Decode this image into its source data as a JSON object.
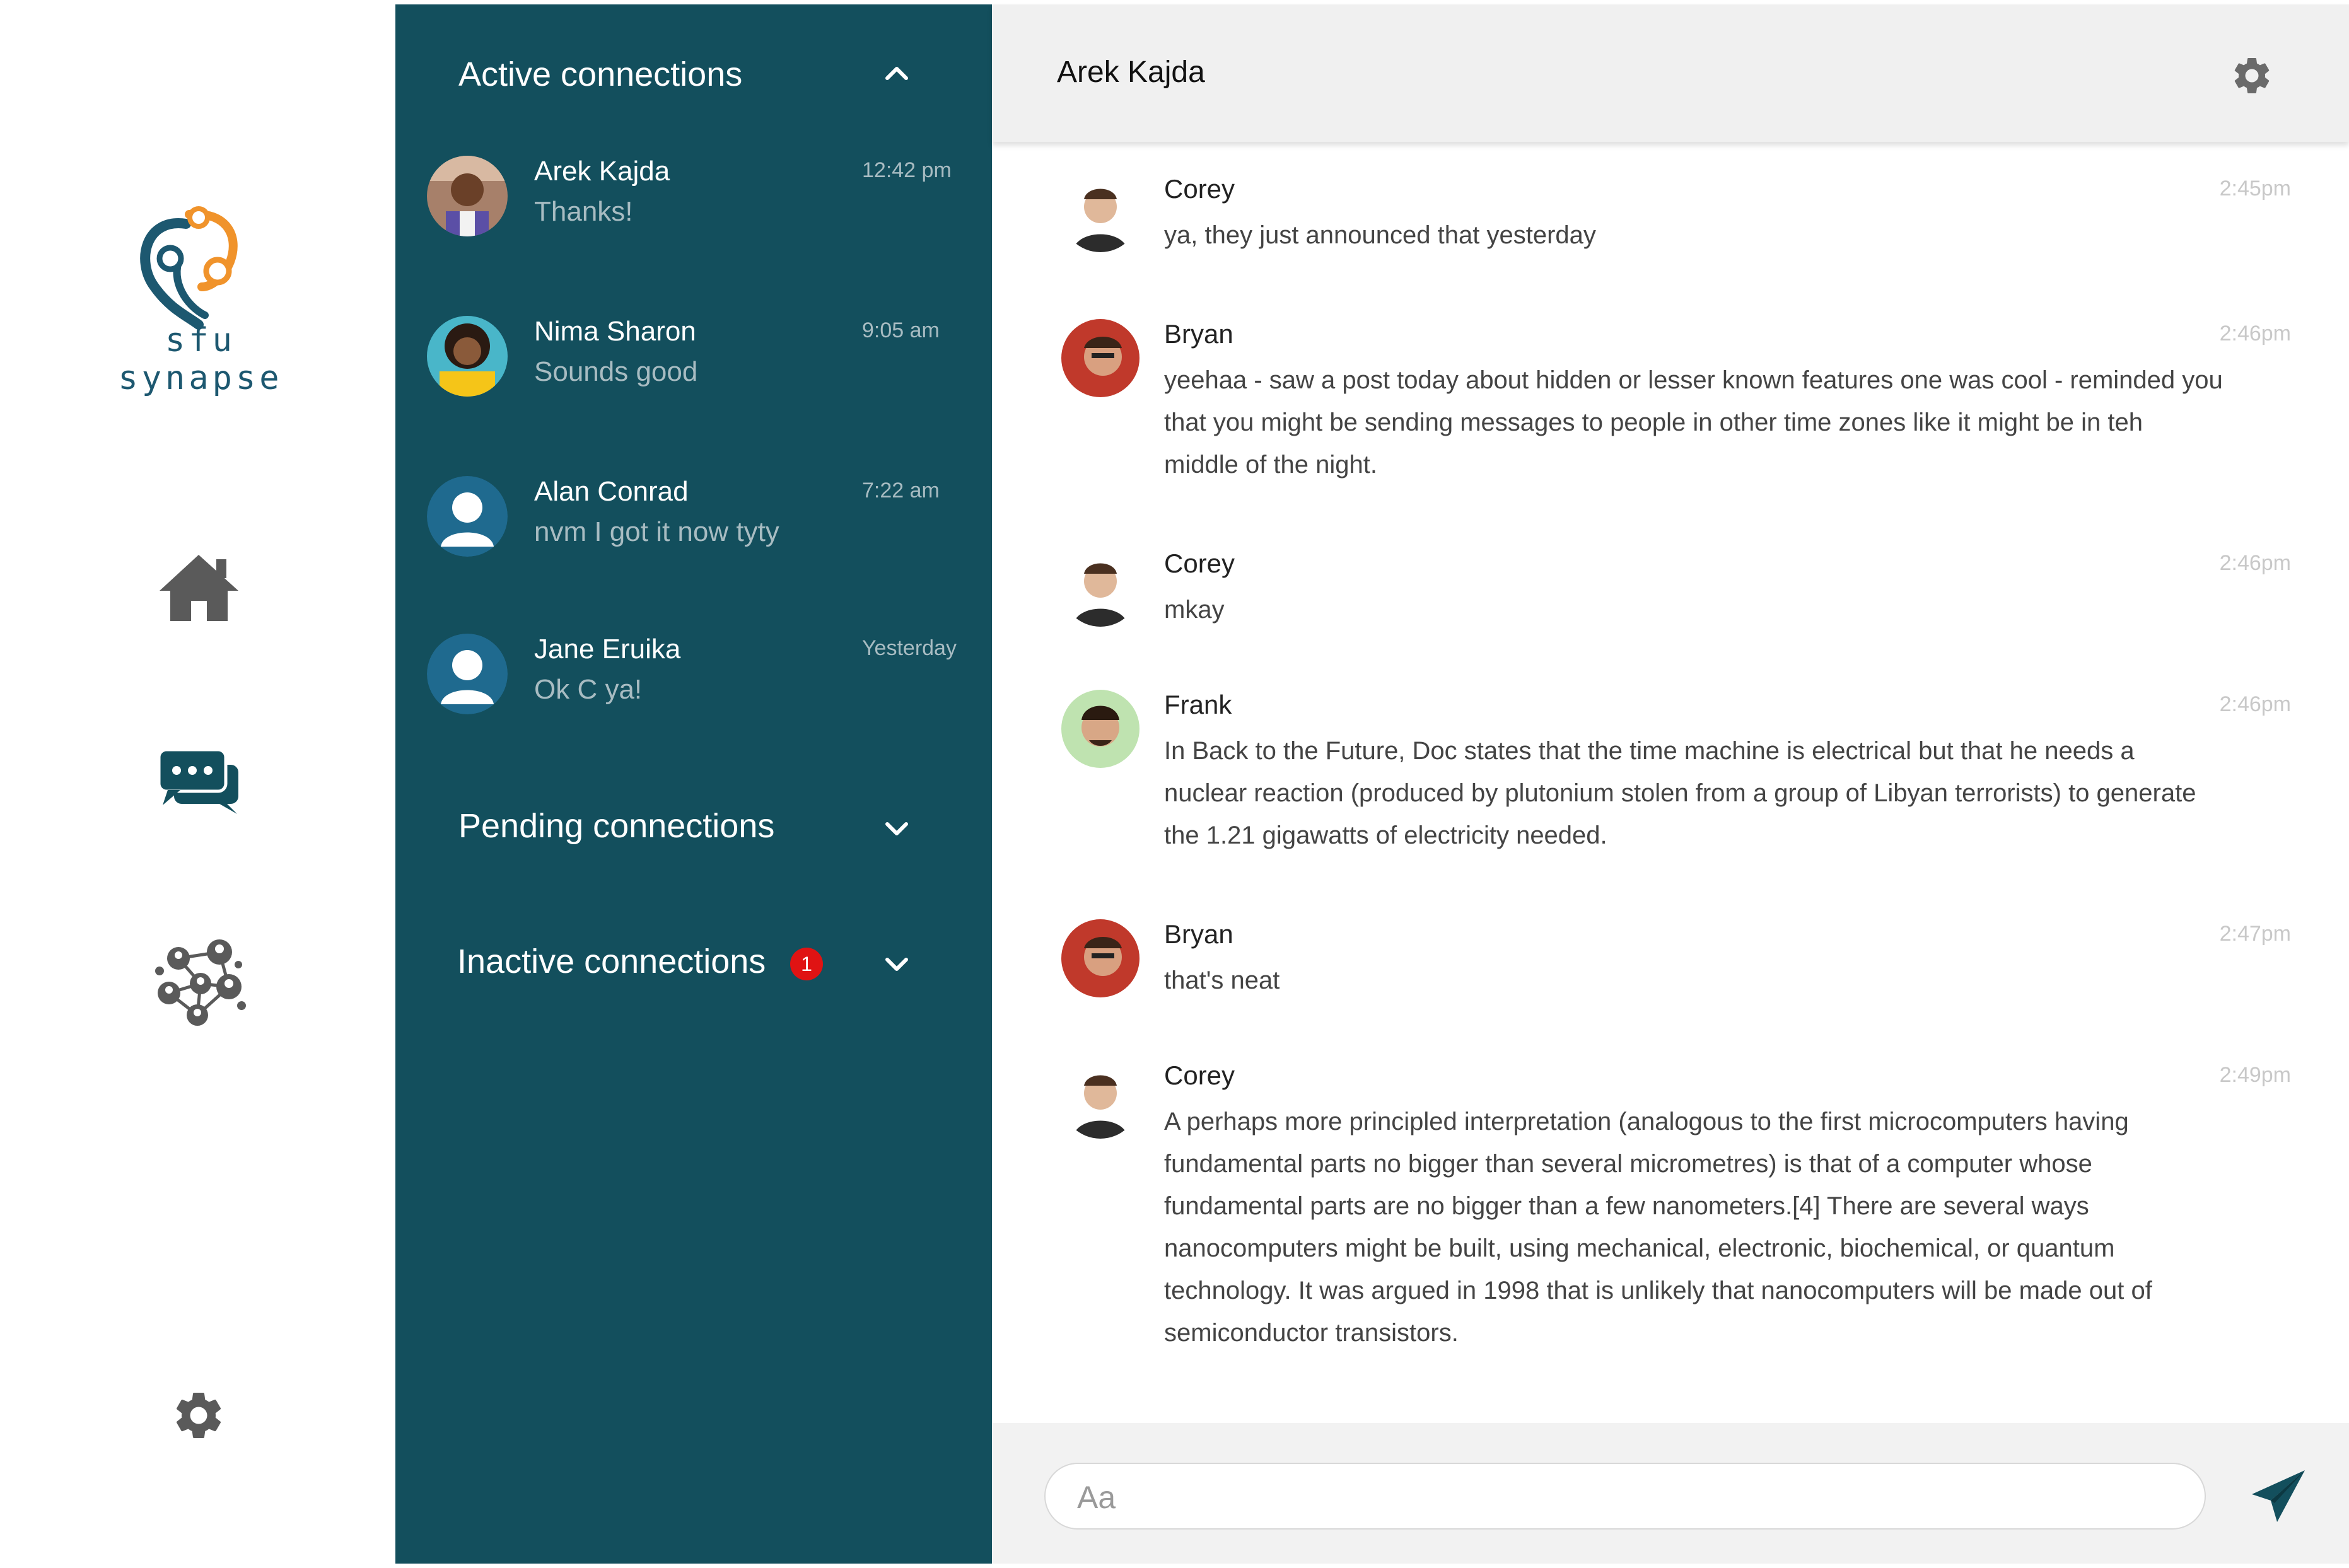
{
  "brand": {
    "name": "sfu synapse"
  },
  "nav": {
    "home_icon": "home-icon",
    "messages_icon": "chat-bubbles-icon",
    "network_icon": "network-icon",
    "settings_icon": "gear-icon"
  },
  "connections": {
    "active_title": "Active connections",
    "pending_title": "Pending connections",
    "inactive_title": "Inactive connections",
    "inactive_badge": "1",
    "contacts": [
      {
        "name": "Arek Kajda",
        "last_message": "Thanks!",
        "time": "12:42 pm"
      },
      {
        "name": "Nima Sharon",
        "last_message": "Sounds good",
        "time": "9:05 am"
      },
      {
        "name": "Alan Conrad",
        "last_message": "nvm I got it now tyty",
        "time": "7:22 am"
      },
      {
        "name": "Jane Eruika",
        "last_message": "Ok C ya!",
        "time": "Yesterday"
      }
    ]
  },
  "chat": {
    "title": "Arek Kajda",
    "messages": [
      {
        "sender": "Corey",
        "time": "2:45pm",
        "text": "ya, they just announced that yesterday"
      },
      {
        "sender": "Bryan",
        "time": "2:46pm",
        "text": "yeehaa - saw a post today about hidden or lesser known features one was cool - reminded you that you might be sending messages to people in other time zones like it might be in teh middle of the night."
      },
      {
        "sender": "Corey",
        "time": "2:46pm",
        "text": "mkay"
      },
      {
        "sender": "Frank",
        "time": "2:46pm",
        "text": "In Back to the Future, Doc states that the time machine is electrical but that he needs a nuclear reaction (produced by plutonium stolen from a group of Libyan terrorists) to generate the 1.21 gigawatts of electricity needed."
      },
      {
        "sender": "Bryan",
        "time": "2:47pm",
        "text": "that's neat"
      },
      {
        "sender": "Corey",
        "time": "2:49pm",
        "text": "A perhaps more principled interpretation (analogous to the first microcomputers having fundamental parts no bigger than several micrometres) is that of a computer whose fundamental parts are no bigger than a few nanometers.[4] There are several ways nanocomputers might be built, using mechanical, electronic, biochemical, or quantum technology. It was argued in 1998 that is unlikely that nanocomputers will be made out of semiconductor transistors."
      }
    ],
    "input_placeholder": "Aa"
  },
  "colors": {
    "panel": "#134f5d",
    "accent_orange": "#f0932b",
    "badge": "#e01313",
    "icon_gray": "#5a5a5a"
  }
}
